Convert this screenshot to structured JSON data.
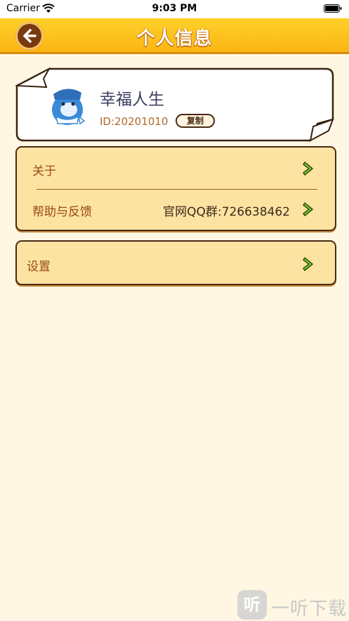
{
  "status_bar": {
    "carrier": "Carrier",
    "time": "9:03 PM"
  },
  "nav": {
    "title": "个人信息"
  },
  "profile": {
    "name": "幸福人生",
    "id": "ID:20201010",
    "copy_label": "复制"
  },
  "menu": {
    "group1": [
      {
        "label": "关于",
        "value": ""
      },
      {
        "label": "帮助与反馈",
        "value": "官网QQ群:726638462"
      }
    ],
    "group2": [
      {
        "label": "设置",
        "value": ""
      }
    ]
  },
  "watermark": {
    "text": "一听下载",
    "glyph": "听"
  },
  "colors": {
    "background": "#fff7e3",
    "nav_yellow": "#fbb414",
    "menu_fill": "#fde3a2",
    "border_brown": "#4a2a12",
    "label_brown": "#9a4a14",
    "chevron_green": "#7acb1c"
  }
}
